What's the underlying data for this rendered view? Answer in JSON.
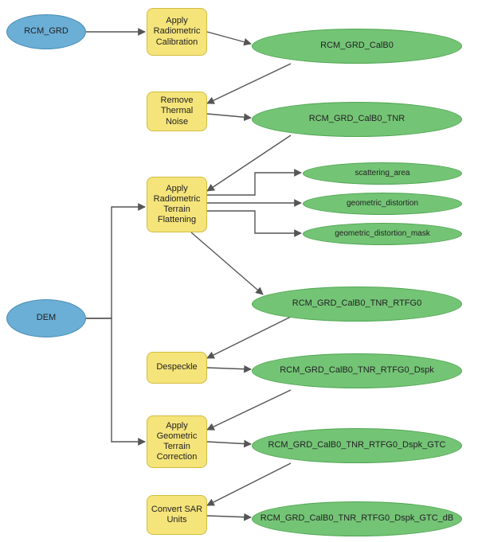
{
  "inputs": {
    "rcm_grd": "RCM_GRD",
    "dem": "DEM"
  },
  "processes": {
    "radiometric_calibration": "Apply Radiometric Calibration",
    "remove_thermal_noise": "Remove Thermal Noise",
    "radiometric_terrain_flattening": "Apply Radiometric Terrain Flattening",
    "despeckle": "Despeckle",
    "geometric_terrain_correction": "Apply Geometric Terrain Correction",
    "convert_sar_units": "Convert SAR Units"
  },
  "outputs": {
    "calb0": "RCM_GRD_CalB0",
    "tnr": "RCM_GRD_CalB0_TNR",
    "scattering_area": "scattering_area",
    "geometric_distortion": "geometric_distortion",
    "geometric_distortion_mask": "geometric_distortion_mask",
    "rtfg0": "RCM_GRD_CalB0_TNR_RTFG0",
    "dspk": "RCM_GRD_CalB0_TNR_RTFG0_Dspk",
    "gtc": "RCM_GRD_CalB0_TNR_RTFG0_Dspk_GTC",
    "db": "RCM_GRD_CalB0_TNR_RTFG0_Dspk_GTC_dB"
  },
  "colors": {
    "input": "#6baed6",
    "process": "#f5e47a",
    "output": "#74c476",
    "edge": "#555555"
  }
}
